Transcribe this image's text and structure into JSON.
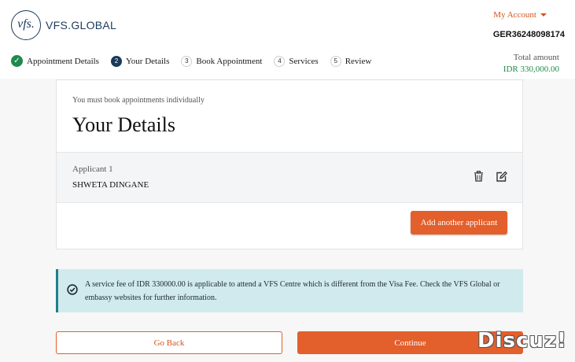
{
  "brand": {
    "logo_mark": "vfs.",
    "name": "VFS.GLOBAL"
  },
  "account": {
    "label": "My Account",
    "reference": "GER36248098174"
  },
  "steps": [
    {
      "number": "✓",
      "label": "Appointment Details",
      "state": "done"
    },
    {
      "number": "2",
      "label": "Your Details",
      "state": "current"
    },
    {
      "number": "3",
      "label": "Book Appointment",
      "state": "upcoming"
    },
    {
      "number": "4",
      "label": "Services",
      "state": "upcoming"
    },
    {
      "number": "5",
      "label": "Review",
      "state": "upcoming"
    }
  ],
  "total": {
    "label": "Total amount",
    "amount": "IDR 330,000.00"
  },
  "card": {
    "note": "You must book appointments individually",
    "title": "Your Details",
    "applicant": {
      "label": "Applicant 1",
      "name": "SHWETA DINGANE"
    },
    "delete_icon": "trash-icon",
    "edit_icon": "edit-icon",
    "add_label": "Add another applicant"
  },
  "info": {
    "icon": "check-circle-icon",
    "text": "A service fee of IDR 330000.00 is applicable to attend a VFS Centre which is different from the Visa Fee. Check the VFS Global or embassy websites for further information."
  },
  "actions": {
    "back_label": "Go Back",
    "continue_label": "Continue"
  },
  "watermark": "Discuz!",
  "colors": {
    "accent": "#e35f2b",
    "brand_navy": "#1b3a5c",
    "success": "#1f8a4c",
    "info_bg": "#d1eaed"
  }
}
